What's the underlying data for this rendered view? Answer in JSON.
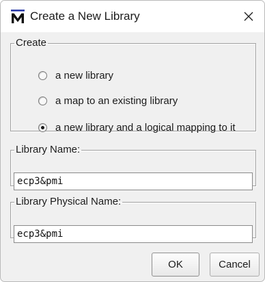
{
  "window": {
    "title": "Create a New Library",
    "app_icon": "m-logo-icon",
    "close_icon": "close-icon"
  },
  "create_group": {
    "legend": "Create",
    "options": [
      {
        "label": "a new library",
        "checked": false
      },
      {
        "label": "a map to an existing library",
        "checked": false
      },
      {
        "label": "a new library and a logical mapping to it",
        "checked": true
      }
    ]
  },
  "library_name": {
    "legend": "Library Name:",
    "value": "ecp3&pmi"
  },
  "library_physical_name": {
    "legend": "Library Physical Name:",
    "value": "ecp3&pmi"
  },
  "buttons": {
    "ok_label": "OK",
    "cancel_label": "Cancel"
  },
  "colors": {
    "icon_blue": "#1f2f8f",
    "background": "#f0f0f0",
    "titlebar": "#ffffff"
  }
}
